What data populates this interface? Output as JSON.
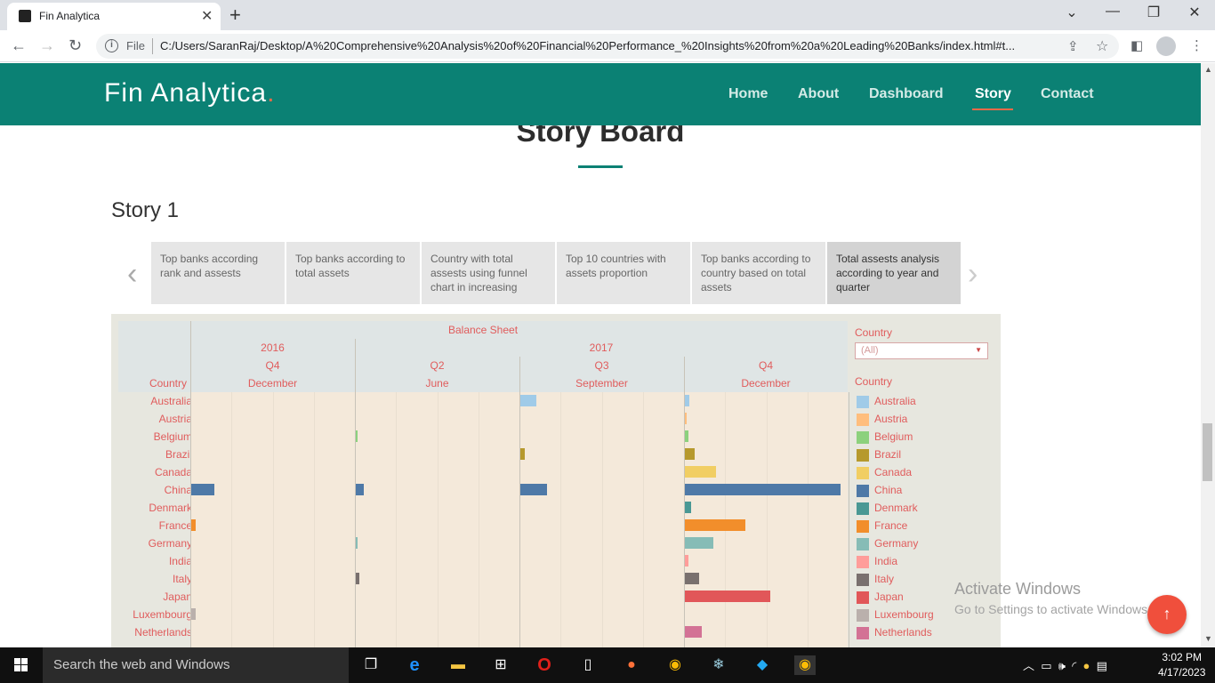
{
  "browser": {
    "tab_title": "Fin Analytica",
    "new_tab": "+",
    "file_label": "File",
    "url": "C:/Users/SaranRaj/Desktop/A%20Comprehensive%20Analysis%20of%20Financial%20Performance_%20Insights%20from%20a%20Leading%20Banks/index.html#t...",
    "controls": {
      "minimize": "—",
      "restore": "❐",
      "close": "✕",
      "tab_search": "⌄"
    }
  },
  "site": {
    "logo": "Fin Analytica",
    "logo_dot": ".",
    "nav": [
      "Home",
      "About",
      "Dashboard",
      "Story",
      "Contact"
    ],
    "active_nav": "Story",
    "accent_color": "#0b8174"
  },
  "storyboard": {
    "title": "Story Board",
    "story_heading": "Story 1",
    "cards": [
      "Top banks according rank and assests",
      "Top banks according to total assets",
      "Country with total assests using funnel chart in increasing",
      "Top 10 countries with assets proportion",
      "Top banks according to country based on total assets",
      "Total assests analysis according to year and quarter"
    ],
    "active_card": 5
  },
  "chart_data": {
    "type": "bar",
    "title": "Balance Sheet",
    "column_hierarchy": [
      {
        "year": "2016",
        "quarter": "Q4",
        "month": "December"
      },
      {
        "year": "2017",
        "quarter": "Q2",
        "month": "June"
      },
      {
        "year": "2017",
        "quarter": "Q3",
        "month": "September"
      },
      {
        "year": "2017",
        "quarter": "Q4",
        "month": "December"
      }
    ],
    "row_header": "Country",
    "categories": [
      "Australia",
      "Austria",
      "Belgium",
      "Brazil",
      "Canada",
      "China",
      "Denmark",
      "France",
      "Germany",
      "India",
      "Italy",
      "Japan",
      "Luxembourg",
      "Netherlands"
    ],
    "series": [
      {
        "values": [
          0,
          0,
          0,
          0,
          0,
          0.15,
          0,
          0.03,
          0,
          0,
          0,
          0,
          0.03,
          0
        ]
      },
      {
        "values": [
          0,
          0,
          0.01,
          0,
          0,
          0.05,
          0,
          0,
          0.01,
          0,
          0.02,
          0,
          0,
          0
        ]
      },
      {
        "values": [
          0.1,
          0,
          0,
          0.03,
          0,
          0.17,
          0,
          0,
          0,
          0,
          0,
          0,
          0,
          0
        ]
      },
      {
        "values": [
          0.03,
          0.005,
          0.02,
          0.06,
          0.2,
          1.0,
          0.04,
          0.39,
          0.18,
          0.02,
          0.09,
          0.55,
          0,
          0.11
        ]
      }
    ],
    "colors": {
      "Australia": "#a0cbe8",
      "Austria": "#ffbe7d",
      "Belgium": "#8cd17d",
      "Brazil": "#b6992d",
      "Canada": "#f1ce63",
      "China": "#4e79a7",
      "Denmark": "#499894",
      "France": "#f28e2b",
      "Germany": "#86bcb6",
      "India": "#ff9d9a",
      "Italy": "#79706e",
      "Japan": "#e15759",
      "Luxembourg": "#bab0ac",
      "Netherlands": "#d37295"
    },
    "legend_title": "Country",
    "filter_title": "Country",
    "filter_value": "(All)"
  },
  "watermark": {
    "line1": "Activate Windows",
    "line2": "Go to Settings to activate Windows."
  },
  "taskbar": {
    "search_placeholder": "Search the web and Windows",
    "time": "3:02 PM",
    "date": "4/17/2023"
  }
}
